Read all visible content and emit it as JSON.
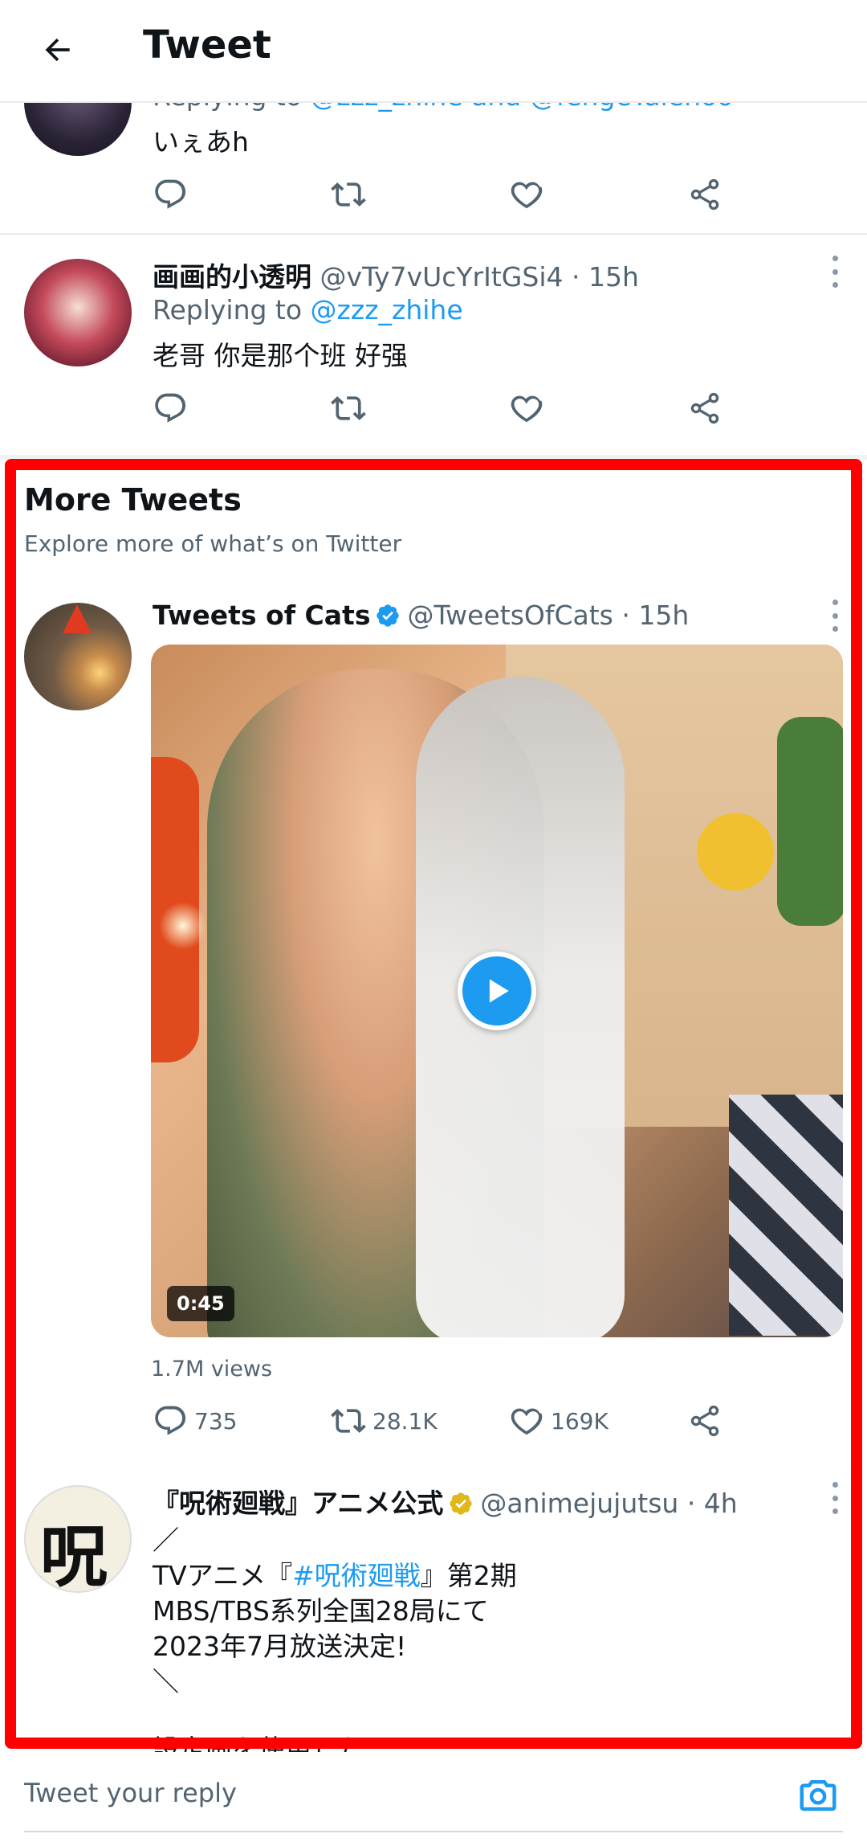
{
  "header": {
    "title": "Tweet"
  },
  "replies": [
    {
      "replying_prefix": "Replying to ",
      "replying_to": "@zzz_zhihe and @fengeYalehoo",
      "text": "いぇあh"
    },
    {
      "name": "画画的小透明",
      "handle": "@vTy7vUcYrItGSi4",
      "time": "· 15h",
      "replying_prefix": "Replying to ",
      "replying_to": "@zzz_zhihe",
      "text": "老哥 你是那个班 好强"
    }
  ],
  "more_tweets": {
    "title": "More Tweets",
    "subtitle": "Explore more of what’s on Twitter",
    "tweets": [
      {
        "name": "Tweets of Cats",
        "handle": "@TweetsOfCats",
        "time": "· 15h",
        "verified_color": "#1d9bf0",
        "duration": "0:45",
        "views": "1.7M views",
        "stats": {
          "replies": "735",
          "retweets": "28.1K",
          "likes": "169K"
        }
      },
      {
        "name": "『呪術廻戦』アニメ公式",
        "handle": "@animejujutsu",
        "time": "· 4h",
        "verified_color": "#e2b719",
        "lines": [
          "／",
          "TVアニメ『",
          "#呪術廻戦",
          "』第2期",
          "MBS/TBS系列全国28局にて",
          "2023年7月放送決定!",
          "＼",
          "設定画を使用した"
        ]
      }
    ]
  },
  "reply_bar": {
    "placeholder": "Tweet your reply"
  },
  "colors": {
    "accent": "#1d9bf0",
    "highlight": "#ff0000",
    "muted": "#536471"
  }
}
